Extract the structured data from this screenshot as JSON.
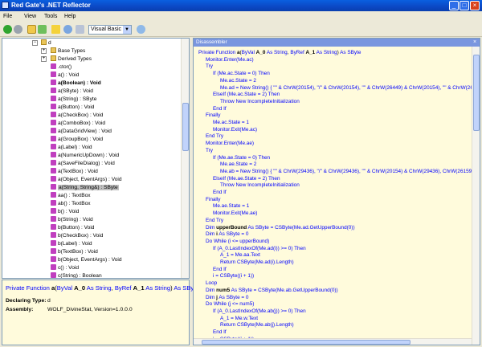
{
  "window": {
    "title": "Red Gate's .NET Reflector"
  },
  "menu": [
    "File",
    "View",
    "Tools",
    "Help"
  ],
  "toolbar": {
    "language": "Visual Basic"
  },
  "tree": {
    "root": "d",
    "folders": [
      "Base Types",
      "Derived Types"
    ],
    "members": [
      ".ctor()",
      "a() : Void",
      "a(Boolean) : Void",
      "a(SByte) : Void",
      "a(String) : SByte",
      "a(Button) : Void",
      "a(CheckBox) : Void",
      "a(ComboBox) : Void",
      "a(DataGridView) : Void",
      "a(GroupBox) : Void",
      "a(Label) : Void",
      "a(NumericUpDown) : Void",
      "a(SaveFileDialog) : Void",
      "a(TextBox) : Void",
      "a(Object, EventArgs) : Void",
      "a(String, String&) : SByte",
      "aa() : TextBox",
      "ab() : TextBox",
      "b() : Void",
      "b(String) : Void",
      "b(Button) : Void",
      "b(CheckBox) : Void",
      "b(Label) : Void",
      "b(TextBox) : Void",
      "b(Object, EventArgs) : Void",
      "c() : Void",
      "c(String) : Boolean",
      "c(Button) : Void",
      "c(CheckBox) : Void"
    ],
    "selected_index": 15,
    "bold_index": 2
  },
  "info": {
    "sig_prefix": "Private Function ",
    "sig_name": "a",
    "sig_params": [
      {
        "t": "(",
        "c": "n"
      },
      {
        "t": "ByVal ",
        "c": "k"
      },
      {
        "t": "A_0",
        "c": "b"
      },
      {
        "t": " As ",
        "c": "k"
      },
      {
        "t": "String",
        "c": "k"
      },
      {
        "t": ", ",
        "c": "n"
      },
      {
        "t": "ByRef ",
        "c": "k"
      },
      {
        "t": "A_1",
        "c": "b"
      },
      {
        "t": " As ",
        "c": "k"
      },
      {
        "t": "String",
        "c": "k"
      },
      {
        "t": ") ",
        "c": "n"
      },
      {
        "t": "As ",
        "c": "k"
      },
      {
        "t": "SByte",
        "c": "k"
      }
    ],
    "declaring_type_label": "Declaring Type:",
    "declaring_type": "d",
    "assembly_label": "Assembly:",
    "assembly": "WOLF_DivineStat, Version=1.0.0.0"
  },
  "disassembler": {
    "title": "Disassembler",
    "lines": [
      {
        "i": 0,
        "s": [
          {
            "t": "Private Function ",
            "c": "k"
          },
          {
            "t": "a",
            "c": "b"
          },
          {
            "t": "(",
            "c": "n"
          },
          {
            "t": "ByVal ",
            "c": "k"
          },
          {
            "t": "A_0",
            "c": "b"
          },
          {
            "t": " As ",
            "c": "k"
          },
          {
            "t": "String",
            "c": "k"
          },
          {
            "t": ", ",
            "c": "n"
          },
          {
            "t": "ByRef ",
            "c": "k"
          },
          {
            "t": "A_1",
            "c": "b"
          },
          {
            "t": " As ",
            "c": "k"
          },
          {
            "t": "String",
            "c": "k"
          },
          {
            "t": ") ",
            "c": "n"
          },
          {
            "t": "As ",
            "c": "k"
          },
          {
            "t": "SByte",
            "c": "k"
          }
        ]
      },
      {
        "i": 1,
        "s": [
          {
            "t": "Monitor.Enter(Me.ac)",
            "c": "k"
          }
        ]
      },
      {
        "i": 1,
        "s": [
          {
            "t": "Try",
            "c": "k"
          }
        ]
      },
      {
        "i": 2,
        "s": [
          {
            "t": "If ",
            "c": "k"
          },
          {
            "t": "(Me.ac.State = 0) ",
            "c": "k"
          },
          {
            "t": "Then",
            "c": "k"
          }
        ]
      },
      {
        "i": 3,
        "s": [
          {
            "t": "Me.ac.State = 2",
            "c": "k"
          }
        ]
      },
      {
        "i": 3,
        "s": [
          {
            "t": "Me.ad = New String() { \"\" & ChrW(20154), \"/\" & ChrW(20154), \"\" & ChrW(26449) & ChrW(20154), \"\" & ChrW(26",
            "c": "k"
          }
        ]
      },
      {
        "i": 2,
        "s": [
          {
            "t": "ElseIf (Me.ac.State = 2) Then",
            "c": "k"
          }
        ]
      },
      {
        "i": 3,
        "s": [
          {
            "t": "Throw New IncompleteInitialization",
            "c": "k"
          }
        ]
      },
      {
        "i": 2,
        "s": [
          {
            "t": "End If",
            "c": "k"
          }
        ]
      },
      {
        "i": 1,
        "s": [
          {
            "t": "Finally",
            "c": "k"
          }
        ]
      },
      {
        "i": 2,
        "s": [
          {
            "t": "Me.ac.State = 1",
            "c": "k"
          }
        ]
      },
      {
        "i": 2,
        "s": [
          {
            "t": "Monitor.Exit(Me.ac)",
            "c": "k"
          }
        ]
      },
      {
        "i": 1,
        "s": [
          {
            "t": "End Try",
            "c": "k"
          }
        ]
      },
      {
        "i": 1,
        "s": [
          {
            "t": "Monitor.Enter(Me.ae)",
            "c": "k"
          }
        ]
      },
      {
        "i": 1,
        "s": [
          {
            "t": "Try",
            "c": "k"
          }
        ]
      },
      {
        "i": 2,
        "s": [
          {
            "t": "If (Me.ae.State = 0) Then",
            "c": "k"
          }
        ]
      },
      {
        "i": 3,
        "s": [
          {
            "t": "Me.ae.State = 2",
            "c": "k"
          }
        ]
      },
      {
        "i": 3,
        "s": [
          {
            "t": "Me.ab = New String() { \"\" & ChrW(29436), \"/\" & ChrW(29436), \"\" & ChrW(20154) & ChrW(29436), ChrW(26159)",
            "c": "k"
          }
        ]
      },
      {
        "i": 2,
        "s": [
          {
            "t": "ElseIf (Me.ae.State = 2) Then",
            "c": "k"
          }
        ]
      },
      {
        "i": 3,
        "s": [
          {
            "t": "Throw New IncompleteInitialization",
            "c": "k"
          }
        ]
      },
      {
        "i": 2,
        "s": [
          {
            "t": "End If",
            "c": "k"
          }
        ]
      },
      {
        "i": 1,
        "s": [
          {
            "t": "Finally",
            "c": "k"
          }
        ]
      },
      {
        "i": 2,
        "s": [
          {
            "t": "Me.ae.State = 1",
            "c": "k"
          }
        ]
      },
      {
        "i": 2,
        "s": [
          {
            "t": "Monitor.Exit(Me.ae)",
            "c": "k"
          }
        ]
      },
      {
        "i": 1,
        "s": [
          {
            "t": "End Try",
            "c": "k"
          }
        ]
      },
      {
        "i": 1,
        "s": [
          {
            "t": "Dim ",
            "c": "k"
          },
          {
            "t": "upperBound",
            "c": "b"
          },
          {
            "t": " As SByte = CSByte(Me.ad.GetUpperBound(0))",
            "c": "k"
          }
        ]
      },
      {
        "i": 1,
        "s": [
          {
            "t": "Dim ",
            "c": "k"
          },
          {
            "t": "i",
            "c": "b"
          },
          {
            "t": " As SByte = 0",
            "c": "k"
          }
        ]
      },
      {
        "i": 1,
        "s": [
          {
            "t": "Do While (i <= upperBound)",
            "c": "k"
          }
        ]
      },
      {
        "i": 2,
        "s": [
          {
            "t": "If (A_0.LastIndexOf(Me.ad(i)) >= 0) Then",
            "c": "k"
          }
        ]
      },
      {
        "i": 3,
        "s": [
          {
            "t": "A_1 = Me.aa.Text",
            "c": "k"
          }
        ]
      },
      {
        "i": 3,
        "s": [
          {
            "t": "Return CSByte(Me.ad(i).Length)",
            "c": "k"
          }
        ]
      },
      {
        "i": 2,
        "s": [
          {
            "t": "End If",
            "c": "k"
          }
        ]
      },
      {
        "i": 2,
        "s": [
          {
            "t": "i = CSByte((i + 1))",
            "c": "k"
          }
        ]
      },
      {
        "i": 1,
        "s": [
          {
            "t": "Loop",
            "c": "k"
          }
        ]
      },
      {
        "i": 1,
        "s": [
          {
            "t": "Dim ",
            "c": "k"
          },
          {
            "t": "num5",
            "c": "b"
          },
          {
            "t": " As SByte = CSByte(Me.ab.GetUpperBound(0))",
            "c": "k"
          }
        ]
      },
      {
        "i": 1,
        "s": [
          {
            "t": "Dim ",
            "c": "k"
          },
          {
            "t": "j",
            "c": "b"
          },
          {
            "t": " As SByte = 0",
            "c": "k"
          }
        ]
      },
      {
        "i": 1,
        "s": [
          {
            "t": "Do While (j <= num5)",
            "c": "k"
          }
        ]
      },
      {
        "i": 2,
        "s": [
          {
            "t": "If (A_0.LastIndexOf(Me.ab(j)) >= 0) Then",
            "c": "k"
          }
        ]
      },
      {
        "i": 3,
        "s": [
          {
            "t": "A_1 = Me.w.Text",
            "c": "k"
          }
        ]
      },
      {
        "i": 3,
        "s": [
          {
            "t": "Return CSByte(Me.ab(j).Length)",
            "c": "k"
          }
        ]
      },
      {
        "i": 2,
        "s": [
          {
            "t": "End If",
            "c": "k"
          }
        ]
      },
      {
        "i": 2,
        "s": [
          {
            "t": "j = CSByte((j + 1))",
            "c": "k"
          }
        ]
      }
    ]
  },
  "colors": {
    "keyword": "#0000ff",
    "panel_bg": "#fffbdc",
    "header": "#7a96df"
  },
  "icons": [
    "back-icon",
    "forward-icon",
    "open-icon",
    "refresh-icon",
    "bookmark-icon",
    "search-icon",
    "options-icon",
    "web-icon"
  ]
}
